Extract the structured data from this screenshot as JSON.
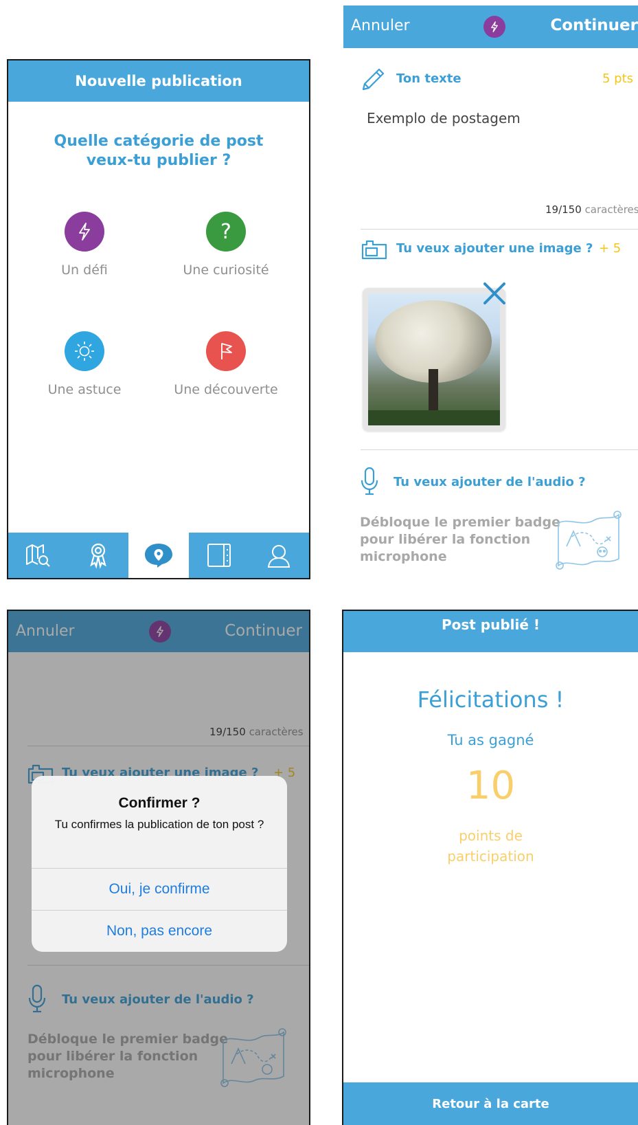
{
  "colors": {
    "accent": "#49a7dc",
    "link_blue": "#3b9fd6",
    "defi_purple": "#8b3d9e",
    "curiosite_green": "#3a9a3f",
    "astuce_cyan": "#2fa6e0",
    "decouverte_red": "#e8524f",
    "points_yellow": "#f5c518"
  },
  "screen1": {
    "title": "Nouvelle publication",
    "question_line1": "Quelle catégorie de post",
    "question_line2": "veux-tu publier ?",
    "categories": [
      {
        "label": "Un défi",
        "icon": "lightning-icon"
      },
      {
        "label": "Une curiosité",
        "icon": "question-mark-icon"
      },
      {
        "label": "Une astuce",
        "icon": "sun-icon"
      },
      {
        "label": "Une découverte",
        "icon": "flag-icon"
      }
    ],
    "nav": [
      "map-search-icon",
      "badge-icon",
      "post-location-icon",
      "journal-icon",
      "profile-icon"
    ]
  },
  "screen2": {
    "cancel": "Annuler",
    "continue": "Continuer",
    "text_section": {
      "title": "Ton texte",
      "points": "5 pts"
    },
    "post_text": "Exemplo de postagem",
    "counter": {
      "count": "19/150",
      "unit": "caractères"
    },
    "image_section": {
      "title": "Tu veux ajouter une image ?",
      "points": "+ 5"
    },
    "audio_section": {
      "title": "Tu veux ajouter de l'audio ?"
    },
    "locked_line1": "Débloque le premier badge",
    "locked_line2": "pour libérer la fonction",
    "locked_line3": "microphone"
  },
  "screen3": {
    "cancel": "Annuler",
    "continue": "Continuer",
    "counter": {
      "count": "19/150",
      "unit": "caractères"
    },
    "image_section": {
      "title": "Tu veux ajouter une image ?",
      "points": "+ 5"
    },
    "audio_section": {
      "title": "Tu veux ajouter de l'audio ?"
    },
    "locked_line1": "Débloque le premier badge",
    "locked_line2": "pour libérer la fonction",
    "locked_line3": "microphone",
    "dialog": {
      "title": "Confirmer ?",
      "message": "Tu confirmes la publication de ton post ?",
      "confirm": "Oui, je confirme",
      "cancel": "Non, pas encore"
    }
  },
  "screen4": {
    "title": "Post publié !",
    "congrats": "Félicitations !",
    "won": "Tu as gagné",
    "points": "10",
    "points_label_line1": "points de",
    "points_label_line2": "participation",
    "back_button": "Retour à la carte"
  }
}
